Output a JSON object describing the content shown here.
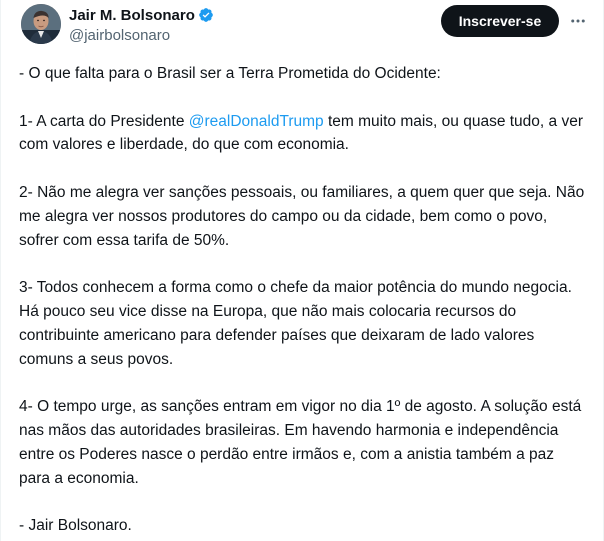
{
  "author": {
    "display_name": "Jair M. Bolsonaro",
    "handle": "@jairbolsonaro",
    "verified": true,
    "verified_color": "#1d9bf0"
  },
  "actions": {
    "subscribe_label": "Inscrever-se",
    "more_icon": "more-horizontal-icon"
  },
  "tweet": {
    "p1": "- O que falta para o Brasil ser a Terra Prometida do Ocidente:",
    "p2_before": "1- A carta do Presidente ",
    "p2_mention": "@realDonaldTrump",
    "p2_after": " tem muito mais, ou quase tudo, a ver com valores e liberdade, do que com economia.",
    "p3": "2- Não me alegra ver sanções pessoais, ou familiares, a quem quer que seja. Não me alegra ver nossos produtores do campo ou da cidade, bem como o povo, sofrer com essa tarifa de 50%.",
    "p4": "3- Todos conhecem a forma como o chefe da maior potência do mundo negocia. Há pouco seu vice disse na Europa, que não mais colocaria recursos do contribuinte americano para defender países que deixaram de lado valores comuns a seus povos.",
    "p5": "4- O tempo urge, as sanções entram em vigor no dia 1º de agosto. A solução está nas mãos das autoridades brasileiras. Em havendo harmonia e independência entre os Poderes nasce o perdão entre irmãos e, com a anistia também a paz para a economia.",
    "p6": "- Jair Bolsonaro."
  },
  "colors": {
    "text": "#0f1419",
    "secondary": "#536471",
    "link": "#1d9bf0",
    "button_bg": "#0f1419"
  }
}
